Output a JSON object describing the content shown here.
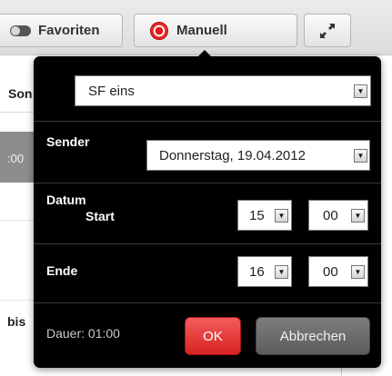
{
  "toolbar": {
    "favorites_label": "Favoriten",
    "manual_label": "Manuell"
  },
  "table": {
    "header_cell": "Son",
    "selected_cell": ":00",
    "bottom_cell": "bis"
  },
  "popup": {
    "channel_select": "SF eins",
    "sender_label": "Sender",
    "date_select": "Donnerstag, 19.04.2012",
    "datum_label": "Datum",
    "start_label": "Start",
    "start_hour": "15",
    "start_minute": "00",
    "end_label": "Ende",
    "end_hour": "16",
    "end_minute": "00",
    "duration_text": "Dauer: 01:00",
    "ok_label": "OK",
    "cancel_label": "Abbrechen"
  },
  "colors": {
    "ok_button": "#e53a3a",
    "cancel_button": "#6b6b6b",
    "popup_background": "#000000",
    "selected_row": "#8d8d8d"
  },
  "icons": {
    "favorites": "toggle-icon",
    "manual": "record-icon",
    "fullscreen": "expand-icon",
    "dropdown": "triangle-down-icon"
  }
}
